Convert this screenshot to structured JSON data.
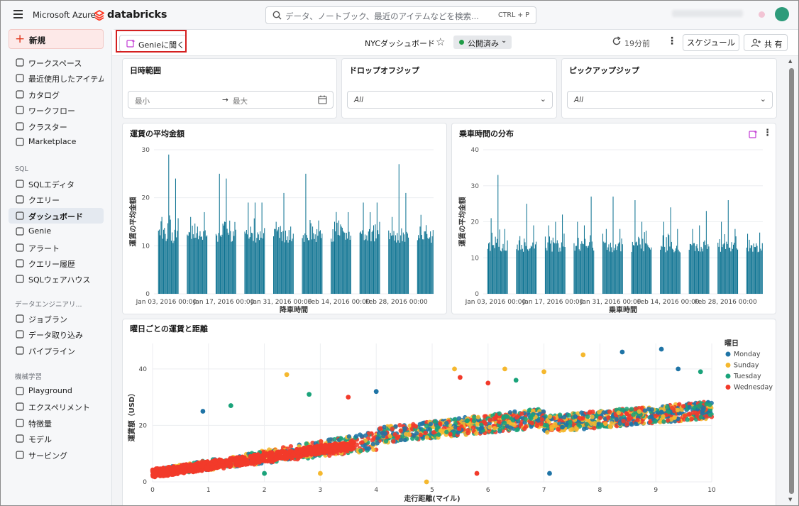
{
  "topbar": {
    "brand": "Microsoft Azure",
    "product": "databricks",
    "search_placeholder": "データ、ノートブック、最近のアイテムなどを検索...",
    "search_shortcut": "CTRL + P"
  },
  "sidebar": {
    "new_label": "新規",
    "items_main": [
      {
        "label": "ワークスペース",
        "icon": "workspace-icon"
      },
      {
        "label": "最近使用したアイテム",
        "icon": "recent-icon"
      },
      {
        "label": "カタログ",
        "icon": "catalog-icon"
      },
      {
        "label": "ワークフロー",
        "icon": "workflow-icon"
      },
      {
        "label": "クラスター",
        "icon": "cluster-icon"
      },
      {
        "label": "Marketplace",
        "icon": "marketplace-icon"
      }
    ],
    "section_sql": "SQL",
    "items_sql": [
      {
        "label": "SQLエディタ",
        "icon": "sql-editor-icon"
      },
      {
        "label": "クエリー",
        "icon": "query-icon"
      },
      {
        "label": "ダッシュボード",
        "icon": "dashboard-icon",
        "active": true
      },
      {
        "label": "Genie",
        "icon": "genie-icon"
      },
      {
        "label": "アラート",
        "icon": "alert-icon"
      },
      {
        "label": "クエリー履歴",
        "icon": "history-icon"
      },
      {
        "label": "SQLウェアハウス",
        "icon": "warehouse-icon"
      }
    ],
    "section_de": "データエンジニアリ...",
    "items_de": [
      {
        "label": "ジョブラン",
        "icon": "job-icon"
      },
      {
        "label": "データ取り込み",
        "icon": "ingest-icon"
      },
      {
        "label": "パイプライン",
        "icon": "pipeline-icon"
      }
    ],
    "section_ml": "機械学習",
    "items_ml": [
      {
        "label": "Playground",
        "icon": "playground-icon"
      },
      {
        "label": "エクスペリメント",
        "icon": "experiment-icon"
      },
      {
        "label": "特徴量",
        "icon": "feature-icon"
      },
      {
        "label": "モデル",
        "icon": "model-icon"
      },
      {
        "label": "サービング",
        "icon": "serving-icon"
      }
    ]
  },
  "dashboard": {
    "genie_button": "Genieに聞く",
    "title": "NYCダッシュボード",
    "status": "公開済み",
    "updated": "19分前",
    "schedule_button": "スケジュール",
    "share_button": "共 有"
  },
  "filters": {
    "date_range": {
      "title": "日時範囲",
      "min_placeholder": "最小",
      "max_placeholder": "最大"
    },
    "dropoff_zip": {
      "title": "ドロップオフジップ",
      "value": "All"
    },
    "pickup_zip": {
      "title": "ピックアップジップ",
      "value": "All"
    }
  },
  "colors": {
    "bar": "#0c7291",
    "monday": "#1f74a6",
    "sunday": "#f5b82e",
    "tuesday": "#1aa37a",
    "wednesday": "#f23a2a",
    "accent_red": "#e1361c"
  },
  "chart_data": [
    {
      "type": "bar",
      "title": "運賃の平均金額",
      "xlabel": "降車時間",
      "ylabel": "運賃の平均金額",
      "ylim": [
        0,
        30
      ],
      "y_ticks": [
        0,
        10,
        20,
        30
      ],
      "x_tick_labels": [
        "Jan 03, 2016 00:00",
        "Jan 17, 2016 00:00",
        "Jan 31, 2016 00:00",
        "Feb 14, 2016 00:00",
        "Feb 28, 2016 00:00"
      ],
      "clusters": [
        {
          "start": "2016-01-01",
          "end": "2016-01-05",
          "base": 12,
          "peaks": [
            16,
            29,
            24
          ]
        },
        {
          "start": "2016-01-08",
          "end": "2016-01-12",
          "base": 12,
          "peaks": [
            16,
            14,
            17
          ]
        },
        {
          "start": "2016-01-15",
          "end": "2016-01-19",
          "base": 12,
          "peaks": [
            25,
            24,
            13
          ]
        },
        {
          "start": "2016-01-22",
          "end": "2016-01-26",
          "base": 12,
          "peaks": [
            19,
            19,
            19
          ]
        },
        {
          "start": "2016-01-29",
          "end": "2016-02-02",
          "base": 12,
          "peaks": [
            13,
            21,
            14
          ]
        },
        {
          "start": "2016-02-05",
          "end": "2016-02-09",
          "base": 12,
          "peaks": [
            25,
            14,
            13
          ]
        },
        {
          "start": "2016-02-12",
          "end": "2016-02-16",
          "base": 12,
          "peaks": [
            15,
            14,
            17
          ]
        },
        {
          "start": "2016-02-19",
          "end": "2016-02-23",
          "base": 12,
          "peaks": [
            19,
            17,
            19
          ]
        },
        {
          "start": "2016-02-26",
          "end": "2016-03-01",
          "base": 12,
          "peaks": [
            16,
            27,
            21
          ]
        },
        {
          "start": "2016-03-04",
          "end": "2016-03-07",
          "base": 12,
          "peaks": [
            14,
            13,
            13
          ]
        }
      ]
    },
    {
      "type": "bar",
      "title": "乗車時間の分布",
      "xlabel": "乗車時間",
      "ylabel": "運賃の平均金額",
      "ylim": [
        0,
        40
      ],
      "y_ticks": [
        0,
        10,
        20,
        30,
        40
      ],
      "x_tick_labels": [
        "Jan 03, 2016 00:00",
        "Jan 17, 2016 00:00",
        "Jan 31, 2016 00:00",
        "Feb 14, 2016 00:00",
        "Feb 28, 2016 00:00"
      ],
      "clusters": [
        {
          "start": "2016-01-01",
          "end": "2016-01-05",
          "base": 13,
          "peaks": [
            21,
            33,
            18
          ]
        },
        {
          "start": "2016-01-08",
          "end": "2016-01-12",
          "base": 13,
          "peaks": [
            16,
            25,
            19
          ]
        },
        {
          "start": "2016-01-15",
          "end": "2016-01-19",
          "base": 13,
          "peaks": [
            19,
            20,
            22
          ]
        },
        {
          "start": "2016-01-22",
          "end": "2016-01-26",
          "base": 13,
          "peaks": [
            20,
            19,
            27
          ]
        },
        {
          "start": "2016-01-29",
          "end": "2016-02-02",
          "base": 13,
          "peaks": [
            18,
            27,
            18
          ]
        },
        {
          "start": "2016-02-05",
          "end": "2016-02-09",
          "base": 13,
          "peaks": [
            26,
            20,
            13
          ]
        },
        {
          "start": "2016-02-12",
          "end": "2016-02-16",
          "base": 13,
          "peaks": [
            20,
            24,
            18
          ]
        },
        {
          "start": "2016-02-19",
          "end": "2016-02-23",
          "base": 13,
          "peaks": [
            18,
            19,
            23
          ]
        },
        {
          "start": "2016-02-26",
          "end": "2016-03-01",
          "base": 13,
          "peaks": [
            20,
            26,
            18
          ]
        },
        {
          "start": "2016-03-04",
          "end": "2016-03-07",
          "base": 13,
          "peaks": [
            15,
            13,
            17
          ]
        }
      ]
    },
    {
      "type": "scatter",
      "title": "曜日ごとの運賃と距離",
      "xlabel": "走行距離(マイル)",
      "ylabel": "運賃額（USD）",
      "xlim": [
        0,
        10
      ],
      "ylim": [
        0,
        47
      ],
      "x_ticks": [
        0,
        1,
        2,
        3,
        4,
        5,
        6,
        7,
        8,
        9,
        10
      ],
      "y_ticks": [
        0,
        20,
        40
      ],
      "legend_title": "曜日",
      "legend_position": "right",
      "series": [
        {
          "name": "Monday"
        },
        {
          "name": "Sunday"
        },
        {
          "name": "Tuesday"
        },
        {
          "name": "Wednesday"
        }
      ],
      "trend": {
        "intercept": 3,
        "slope": 2.8
      },
      "outliers": [
        {
          "x": 0.9,
          "y": 25,
          "series": "Monday"
        },
        {
          "x": 2.4,
          "y": 38,
          "series": "Sunday"
        },
        {
          "x": 2.8,
          "y": 31,
          "series": "Tuesday"
        },
        {
          "x": 4.0,
          "y": 32,
          "series": "Monday"
        },
        {
          "x": 5.4,
          "y": 40,
          "series": "Sunday"
        },
        {
          "x": 6.3,
          "y": 40,
          "series": "Sunday"
        },
        {
          "x": 7.0,
          "y": 39,
          "series": "Sunday"
        },
        {
          "x": 7.1,
          "y": 3,
          "series": "Monday"
        },
        {
          "x": 7.7,
          "y": 45,
          "series": "Sunday"
        },
        {
          "x": 8.4,
          "y": 46,
          "series": "Monday"
        },
        {
          "x": 9.1,
          "y": 47,
          "series": "Monday"
        },
        {
          "x": 3.0,
          "y": 3,
          "series": "Sunday"
        },
        {
          "x": 4.9,
          "y": 0,
          "series": "Sunday"
        },
        {
          "x": 5.8,
          "y": 3,
          "series": "Wednesday"
        },
        {
          "x": 5.5,
          "y": 37,
          "series": "Wednesday"
        },
        {
          "x": 6.0,
          "y": 35,
          "series": "Wednesday"
        },
        {
          "x": 2.0,
          "y": 3,
          "series": "Tuesday"
        },
        {
          "x": 1.4,
          "y": 27,
          "series": "Tuesday"
        },
        {
          "x": 3.5,
          "y": 30,
          "series": "Wednesday"
        },
        {
          "x": 6.5,
          "y": 36,
          "series": "Tuesday"
        },
        {
          "x": 9.4,
          "y": 40,
          "series": "Monday"
        },
        {
          "x": 9.8,
          "y": 39,
          "series": "Tuesday"
        }
      ]
    }
  ]
}
